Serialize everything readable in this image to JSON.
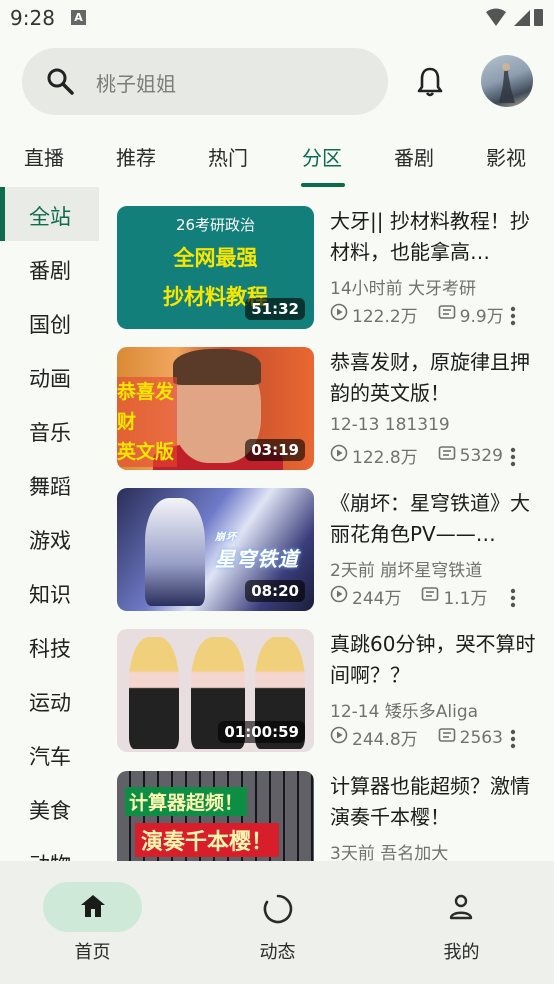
{
  "status": {
    "time": "9:28",
    "badge": "A"
  },
  "search": {
    "placeholder": "桃子姐姐"
  },
  "tabs": [
    {
      "label": "直播",
      "active": false
    },
    {
      "label": "推荐",
      "active": false
    },
    {
      "label": "热门",
      "active": false
    },
    {
      "label": "分区",
      "active": true
    },
    {
      "label": "番剧",
      "active": false
    },
    {
      "label": "影视",
      "active": false
    }
  ],
  "categories": [
    {
      "label": "全站",
      "active": true
    },
    {
      "label": "番剧"
    },
    {
      "label": "国创"
    },
    {
      "label": "动画"
    },
    {
      "label": "音乐"
    },
    {
      "label": "舞蹈"
    },
    {
      "label": "游戏"
    },
    {
      "label": "知识"
    },
    {
      "label": "科技"
    },
    {
      "label": "运动"
    },
    {
      "label": "汽车"
    },
    {
      "label": "美食"
    },
    {
      "label": "动物"
    }
  ],
  "videos": [
    {
      "title": "大牙|| 抄材料教程！抄材料，也能拿高…",
      "meta": "14小时前  大牙考研",
      "views": "122.2万",
      "danmaku": "9.9万",
      "duration": "51:32",
      "thumb_text": [
        "26考研政治",
        "全网最强",
        "抄材料教程"
      ]
    },
    {
      "title": "恭喜发财，原旋律且押韵的英文版！",
      "meta": "12-13  181319",
      "views": "122.8万",
      "danmaku": "5329",
      "duration": "03:19",
      "thumb_text": [
        "恭喜发财",
        "英文版"
      ]
    },
    {
      "title": "《崩坏：星穹铁道》大丽花角色PV——…",
      "meta": "2天前  崩坏星穹铁道",
      "views": "244万",
      "danmaku": "1.1万",
      "duration": "08:20",
      "thumb_text": [
        "崩坏",
        "星穹铁道"
      ]
    },
    {
      "title": "真跳60分钟，哭不算时间啊？？",
      "meta": "12-14  矮乐多Aliga",
      "views": "244.8万",
      "danmaku": "2563",
      "duration": "01:00:59",
      "thumb_text": []
    },
    {
      "title": "计算器也能超频？激情演奏千本樱！",
      "meta": "3天前  吾名加大",
      "views": "",
      "danmaku": "",
      "duration": "",
      "thumb_text": [
        "计算器超频！",
        "演奏千本樱！"
      ]
    }
  ],
  "bottom_nav": [
    {
      "label": "首页",
      "icon": "home-icon",
      "active": true
    },
    {
      "label": "动态",
      "icon": "activity-icon",
      "active": false
    },
    {
      "label": "我的",
      "icon": "person-icon",
      "active": false
    }
  ],
  "colors": {
    "accent": "#0f6b4e",
    "nav_pill": "#cfe9d8",
    "background": "#f8faf6"
  }
}
